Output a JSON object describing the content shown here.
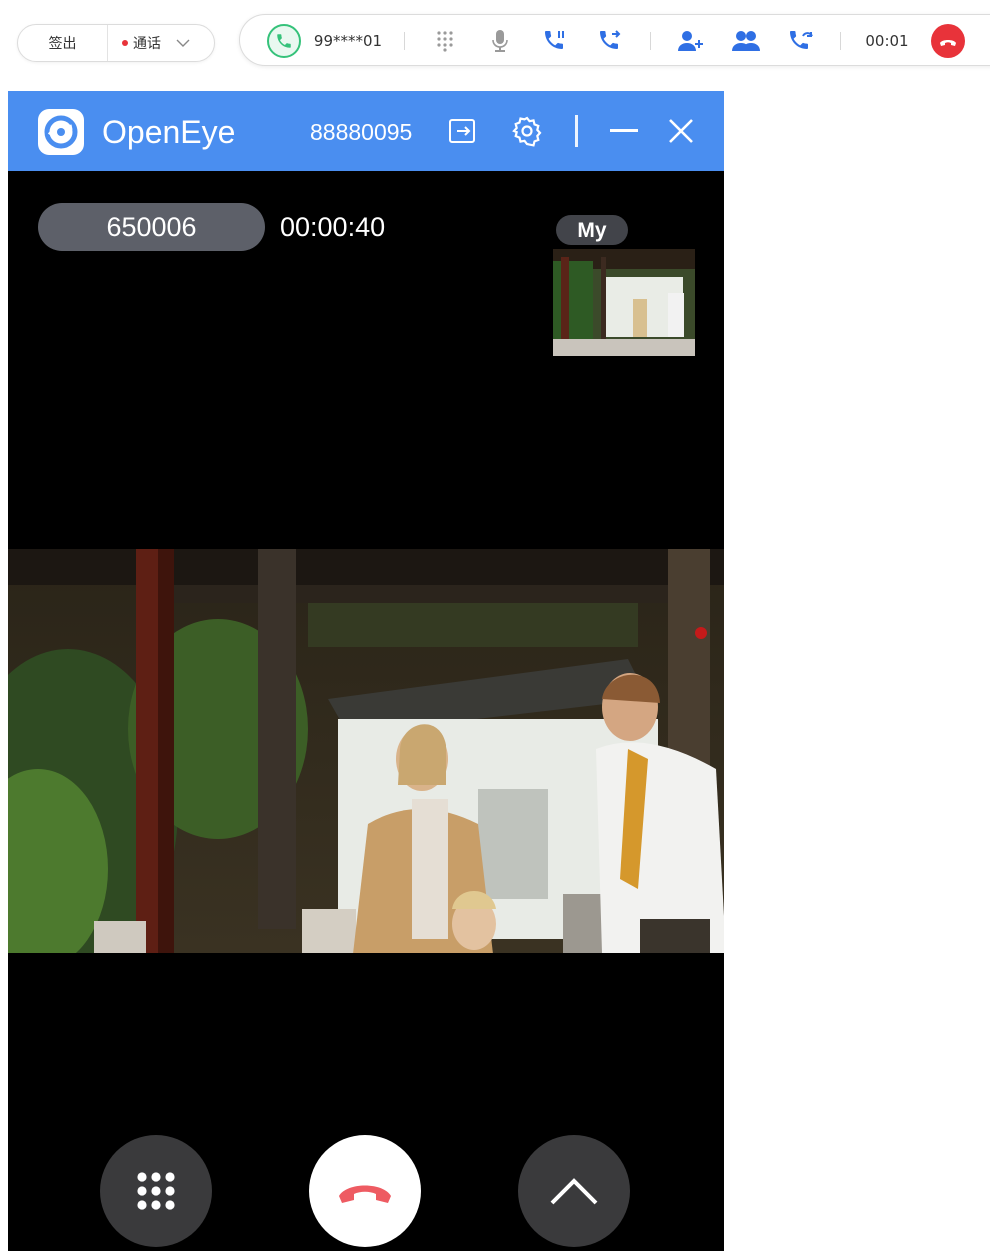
{
  "toolbar": {
    "signout_label": "签出",
    "status_label": "通话",
    "status_color": "#e8333a",
    "call": {
      "number": "99****01",
      "duration": "00:01",
      "icons": [
        "phone-icon",
        "keypad-icon",
        "microphone-icon",
        "hold-call-icon",
        "transfer-call-icon",
        "consult-icon",
        "conference-icon",
        "callback-icon",
        "hangup-icon"
      ]
    }
  },
  "window": {
    "app_name": "OpenEye",
    "account_number": "88880095",
    "accent_color": "#4a8ef0",
    "title_icons": [
      "logout-icon",
      "settings-icon",
      "minimize-icon",
      "close-icon"
    ]
  },
  "video_call": {
    "remote_id": "650006",
    "elapsed": "00:00:40",
    "self_label": "My"
  },
  "controls": {
    "buttons": [
      "keypad-icon",
      "hangup-icon",
      "expand-up-icon"
    ],
    "hangup_color": "#ee5b62"
  }
}
